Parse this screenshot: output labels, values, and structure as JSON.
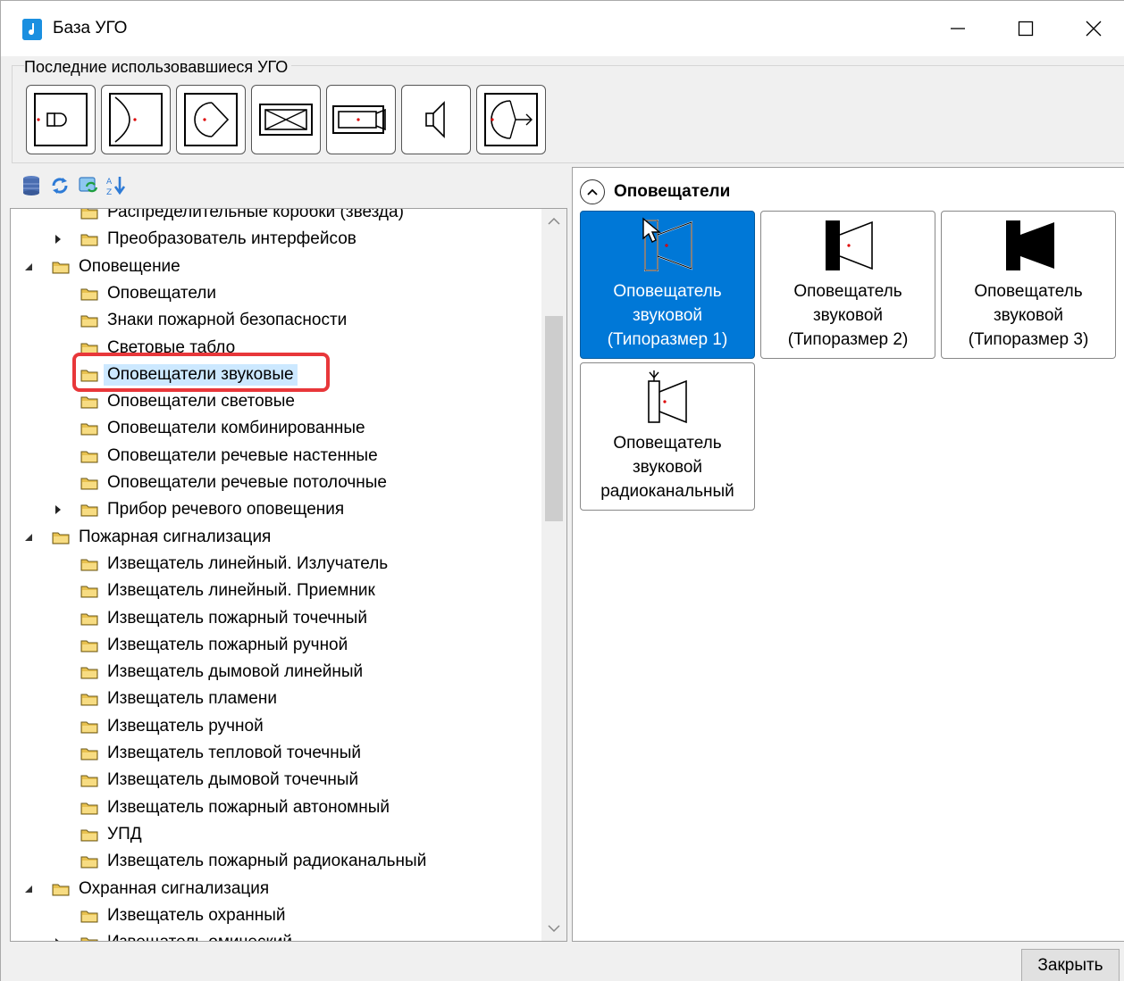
{
  "window": {
    "title": "База УГО"
  },
  "recent": {
    "label": "Последние использовавшиеся УГО",
    "tiles": [
      "speaker-symbol",
      "wall-arc-symbol",
      "semicircle-arrow-symbol",
      "crossed-box-symbol",
      "camera-symbol",
      "horn-symbol",
      "arc-arrow-symbol"
    ]
  },
  "toolbar": {
    "icons": [
      "database-icon",
      "refresh-icon",
      "sync-folder-icon",
      "sort-icon"
    ]
  },
  "tree": {
    "items": [
      {
        "label": "Распределительные коробки (звезда)",
        "level": 1
      },
      {
        "label": "Преобразователь интерфейсов",
        "level": 1,
        "expander": "collapsed"
      },
      {
        "label": "Оповещение",
        "level": 0,
        "expander": "expanded"
      },
      {
        "label": "Оповещатели",
        "level": 1
      },
      {
        "label": "Знаки пожарной безопасности",
        "level": 1
      },
      {
        "label": "Световые табло",
        "level": 1
      },
      {
        "label": "Оповещатели звуковые",
        "level": 1,
        "selected": true
      },
      {
        "label": "Оповещатели световые",
        "level": 1
      },
      {
        "label": "Оповещатели комбинированные",
        "level": 1
      },
      {
        "label": "Оповещатели речевые настенные",
        "level": 1
      },
      {
        "label": "Оповещатели речевые потолочные",
        "level": 1
      },
      {
        "label": "Прибор речевого оповещения",
        "level": 1,
        "expander": "collapsed"
      },
      {
        "label": "Пожарная сигнализация",
        "level": 0,
        "expander": "expanded"
      },
      {
        "label": "Извещатель линейный. Излучатель",
        "level": 1
      },
      {
        "label": "Извещатель линейный. Приемник",
        "level": 1
      },
      {
        "label": "Извещатель пожарный точечный",
        "level": 1
      },
      {
        "label": "Извещатель пожарный ручной",
        "level": 1
      },
      {
        "label": "Извещатель дымовой линейный",
        "level": 1
      },
      {
        "label": "Извещатель пламени",
        "level": 1
      },
      {
        "label": "Извещатель ручной",
        "level": 1
      },
      {
        "label": "Извещатель тепловой точечный",
        "level": 1
      },
      {
        "label": "Извещатель дымовой точечный",
        "level": 1
      },
      {
        "label": "Извещатель пожарный автономный",
        "level": 1
      },
      {
        "label": "УПД",
        "level": 1
      },
      {
        "label": "Извещатель пожарный радиоканальный",
        "level": 1
      },
      {
        "label": "Охранная сигнализация",
        "level": 0,
        "expander": "expanded"
      },
      {
        "label": "Извещатель охранный",
        "level": 1
      },
      {
        "label": "Извещатель омический",
        "level": 1,
        "expander": "collapsed"
      }
    ]
  },
  "gallery": {
    "section_title": "Оповещатели",
    "tiles": [
      {
        "line1": "Оповещатель",
        "line2": "звуковой",
        "line3": "(Типоразмер 1)",
        "selected": true
      },
      {
        "line1": "Оповещатель",
        "line2": "звуковой",
        "line3": "(Типоразмер 2)"
      },
      {
        "line1": "Оповещатель",
        "line2": "звуковой",
        "line3": "(Типоразмер 3)"
      },
      {
        "line1": "Оповещатель",
        "line2": "звуковой",
        "line3": "радиоканальный"
      }
    ]
  },
  "footer": {
    "close_label": "Закрыть"
  },
  "colors": {
    "selection": "#0078d7",
    "tree_selection": "#cce8ff",
    "highlight": "#e8373a",
    "folder": "#e8c14f"
  }
}
